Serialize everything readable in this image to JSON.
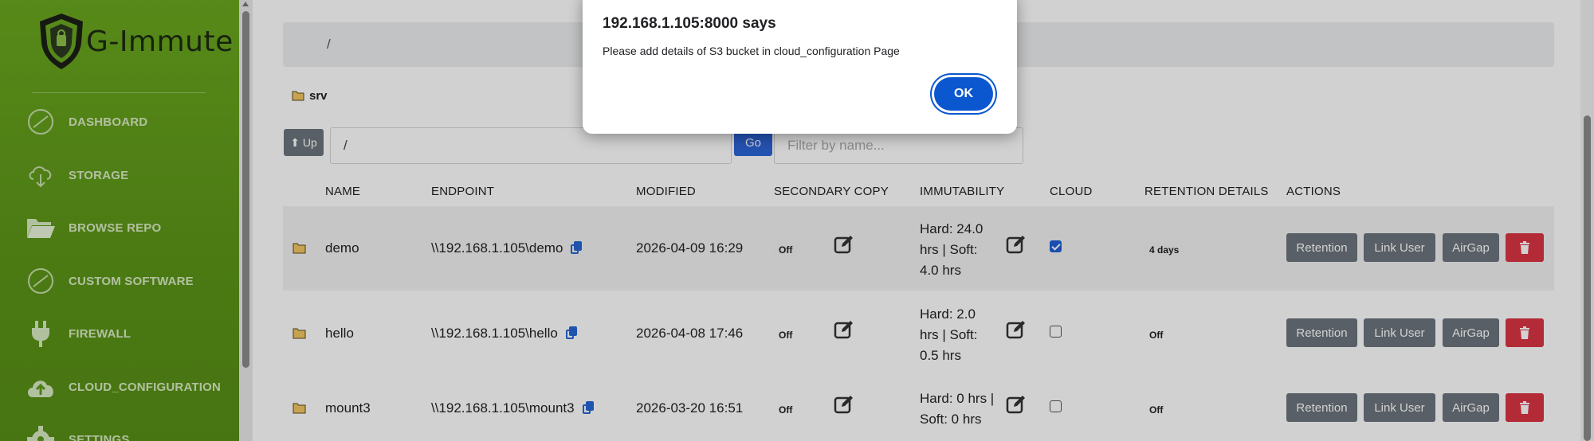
{
  "brand": {
    "name": "G-Immute"
  },
  "sidebar": {
    "items": [
      {
        "label": "DASHBOARD",
        "icon": "gauge-icon"
      },
      {
        "label": "STORAGE",
        "icon": "cloud-download-icon"
      },
      {
        "label": "BROWSE REPO",
        "icon": "folder-open-icon"
      },
      {
        "label": "CUSTOM SOFTWARE",
        "icon": "gauge-icon"
      },
      {
        "label": "FIREWALL",
        "icon": "plug-icon"
      },
      {
        "label": "CLOUD_CONFIGURATION",
        "icon": "cloud-upload-icon"
      },
      {
        "label": "SETTINGS",
        "icon": "gear-icon"
      }
    ]
  },
  "path": {
    "current": "/"
  },
  "folder": {
    "name": "srv"
  },
  "toolbar": {
    "up_label": "⬆ Up",
    "path_value": "/",
    "go_label": "Go",
    "filter_placeholder": "Filter by name..."
  },
  "table": {
    "headers": [
      "NAME",
      "ENDPOINT",
      "MODIFIED",
      "SECONDARY COPY",
      "IMMUTABILITY",
      "CLOUD",
      "RETENTION DETAILS",
      "ACTIONS"
    ],
    "rows": [
      {
        "name": "demo",
        "endpoint": "\\\\192.168.1.105\\demo",
        "modified": "2026-04-09 16:29",
        "secondary": "Off",
        "immut_1": "Hard: 24.0",
        "immut_2": "hrs | Soft:",
        "immut_3": "4.0 hrs",
        "cloud": true,
        "retention": "4 days"
      },
      {
        "name": "hello",
        "endpoint": "\\\\192.168.1.105\\hello",
        "modified": "2026-04-08 17:46",
        "secondary": "Off",
        "immut_1": "Hard: 2.0",
        "immut_2": "hrs | Soft:",
        "immut_3": "0.5 hrs",
        "cloud": false,
        "retention": "Off"
      },
      {
        "name": "mount3",
        "endpoint": "\\\\192.168.1.105\\mount3",
        "modified": "2026-03-20 16:51",
        "secondary": "Off",
        "immut_1": "Hard: 0 hrs |",
        "immut_2": "Soft: 0 hrs",
        "immut_3": "",
        "cloud": false,
        "retention": "Off"
      }
    ],
    "actions": {
      "retention": "Retention",
      "link_user": "Link User",
      "airgap": "AirGap"
    }
  },
  "dialog": {
    "title": "192.168.1.105:8000 says",
    "message": "Please add details of S3 bucket in cloud_configuration Page",
    "ok_label": "OK"
  },
  "colors": {
    "sidebar": "#5f9a1a",
    "primary": "#0b57d0",
    "danger": "#dc3545",
    "secondary": "#6c757d"
  }
}
